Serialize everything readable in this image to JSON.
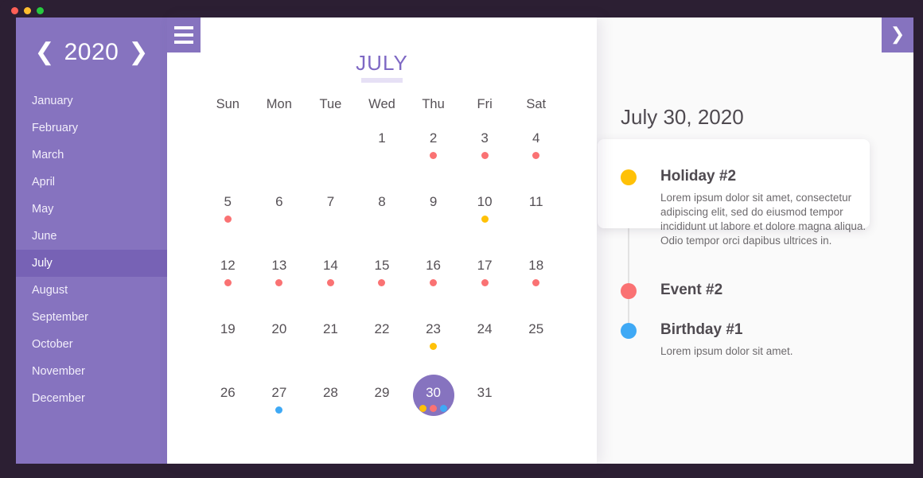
{
  "window": {
    "traffic_lights": [
      {
        "name": "close",
        "color": "#ff5f56"
      },
      {
        "name": "minimize",
        "color": "#ffbd2e"
      },
      {
        "name": "maximize",
        "color": "#27c93f"
      }
    ]
  },
  "theme": {
    "purple": "#8673bf",
    "purple_dark": "#7762b5",
    "purple_text": "#7e68c4",
    "red": "#fa7273",
    "yellow": "#ffc107",
    "blue": "#3fa9f5",
    "panel_bg": "#fafafa"
  },
  "sidebar": {
    "year": "2020",
    "prev_icon": "chevron-left-icon",
    "next_icon": "chevron-right-icon",
    "months": [
      {
        "label": "January",
        "selected": false
      },
      {
        "label": "February",
        "selected": false
      },
      {
        "label": "March",
        "selected": false
      },
      {
        "label": "April",
        "selected": false
      },
      {
        "label": "May",
        "selected": false
      },
      {
        "label": "June",
        "selected": false
      },
      {
        "label": "July",
        "selected": true
      },
      {
        "label": "August",
        "selected": false
      },
      {
        "label": "September",
        "selected": false
      },
      {
        "label": "October",
        "selected": false
      },
      {
        "label": "November",
        "selected": false
      },
      {
        "label": "December",
        "selected": false
      }
    ]
  },
  "menu_button": {
    "icon": "hamburger-icon"
  },
  "next_button": {
    "icon": "chevron-right-icon",
    "label": "❯"
  },
  "calendar": {
    "month_title": "JULY",
    "weekdays": [
      "Sun",
      "Mon",
      "Tue",
      "Wed",
      "Thu",
      "Fri",
      "Sat"
    ],
    "leading_blanks": 3,
    "days": [
      {
        "num": "1",
        "dots": []
      },
      {
        "num": "2",
        "dots": [
          "#fa7273"
        ]
      },
      {
        "num": "3",
        "dots": [
          "#fa7273"
        ]
      },
      {
        "num": "4",
        "dots": [
          "#fa7273"
        ]
      },
      {
        "num": "5",
        "dots": [
          "#fa7273"
        ]
      },
      {
        "num": "6",
        "dots": []
      },
      {
        "num": "7",
        "dots": []
      },
      {
        "num": "8",
        "dots": []
      },
      {
        "num": "9",
        "dots": []
      },
      {
        "num": "10",
        "dots": [
          "#ffc107"
        ]
      },
      {
        "num": "11",
        "dots": []
      },
      {
        "num": "12",
        "dots": [
          "#fa7273"
        ]
      },
      {
        "num": "13",
        "dots": [
          "#fa7273"
        ]
      },
      {
        "num": "14",
        "dots": [
          "#fa7273"
        ]
      },
      {
        "num": "15",
        "dots": [
          "#fa7273"
        ]
      },
      {
        "num": "16",
        "dots": [
          "#fa7273"
        ]
      },
      {
        "num": "17",
        "dots": [
          "#fa7273"
        ]
      },
      {
        "num": "18",
        "dots": [
          "#fa7273"
        ]
      },
      {
        "num": "19",
        "dots": []
      },
      {
        "num": "20",
        "dots": []
      },
      {
        "num": "21",
        "dots": []
      },
      {
        "num": "22",
        "dots": []
      },
      {
        "num": "23",
        "dots": [
          "#ffc107"
        ]
      },
      {
        "num": "24",
        "dots": []
      },
      {
        "num": "25",
        "dots": []
      },
      {
        "num": "26",
        "dots": []
      },
      {
        "num": "27",
        "dots": [
          "#3fa9f5"
        ]
      },
      {
        "num": "28",
        "dots": []
      },
      {
        "num": "29",
        "dots": []
      },
      {
        "num": "30",
        "dots": [
          "#ffc107",
          "#fa7273",
          "#3fa9f5"
        ],
        "selected": true
      },
      {
        "num": "31",
        "dots": []
      }
    ]
  },
  "events": {
    "date_heading": "July 30, 2020",
    "items": [
      {
        "title": "Holiday #2",
        "description": "Lorem ipsum dolor sit amet, consectetur adipiscing elit, sed do eiusmod tempor incididunt ut labore et dolore magna aliqua. Odio tempor orci dapibus ultrices in.",
        "color": "#ffc107",
        "card": true
      },
      {
        "title": "Event #2",
        "description": "",
        "color": "#fa7273",
        "card": false
      },
      {
        "title": "Birthday #1",
        "description": "Lorem ipsum dolor sit amet.",
        "color": "#3fa9f5",
        "card": false
      }
    ]
  }
}
